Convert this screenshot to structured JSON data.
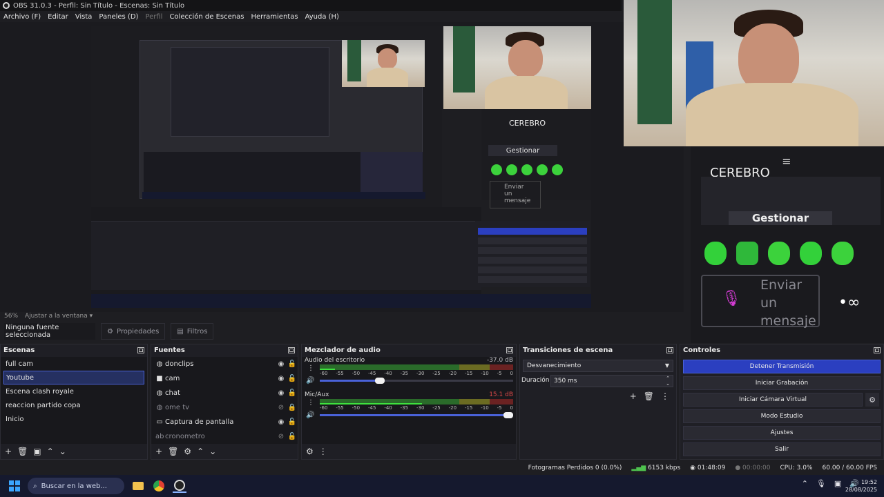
{
  "window": {
    "title": "OBS 31.0.3 - Perfil: Sin Título - Escenas: Sin Título"
  },
  "menu": [
    {
      "label": "Archivo (F)",
      "enabled": true
    },
    {
      "label": "Editar",
      "enabled": true
    },
    {
      "label": "Vista",
      "enabled": true
    },
    {
      "label": "Paneles (D)",
      "enabled": true
    },
    {
      "label": "Perfil",
      "enabled": false
    },
    {
      "label": "Colección de Escenas",
      "enabled": true
    },
    {
      "label": "Herramientas",
      "enabled": true
    },
    {
      "label": "Ayuda (H)",
      "enabled": true
    }
  ],
  "preview": {
    "zoom": "56%",
    "fit_label": "Ajustar a la ventana",
    "chat_overlay": {
      "title": "CEREBRO",
      "manage_label": "Gestionar",
      "send_label": "Enviar un mensaje"
    }
  },
  "source_toolbar": {
    "no_source": "Ninguna fuente seleccionada",
    "properties": "Propiedades",
    "filters": "Filtros"
  },
  "docks": {
    "scenes": {
      "title": "Escenas",
      "items": [
        {
          "label": "full cam",
          "active": false
        },
        {
          "label": "Youtube",
          "active": true
        },
        {
          "label": "Escena clash royale",
          "active": false
        },
        {
          "label": "reaccion partido copa",
          "active": false
        },
        {
          "label": "Inicio",
          "active": false
        }
      ]
    },
    "sources": {
      "title": "Fuentes",
      "items": [
        {
          "label": "donclips",
          "icon": "browser-icon",
          "visible": true,
          "locked": false
        },
        {
          "label": "cam",
          "icon": "camera-icon",
          "visible": true,
          "locked": false
        },
        {
          "label": "chat",
          "icon": "browser-icon",
          "visible": true,
          "locked": false
        },
        {
          "label": "ome tv",
          "icon": "browser-icon",
          "visible": false,
          "locked": true
        },
        {
          "label": "Captura de pantalla",
          "icon": "monitor-icon",
          "visible": true,
          "locked": false
        },
        {
          "label": "cronometro",
          "icon": "text-icon",
          "visible": false,
          "locked": false
        }
      ]
    },
    "mixer": {
      "title": "Mezclador de audio",
      "scale": [
        "-60",
        "-55",
        "-50",
        "-45",
        "-40",
        "-35",
        "-30",
        "-25",
        "-20",
        "-15",
        "-10",
        "-5",
        "0"
      ],
      "channels": [
        {
          "name": "Audio del escritorio",
          "db": "-37.0 dB",
          "db_color": "#b9b9c0",
          "level": 0.08,
          "volume": 0.3
        },
        {
          "name": "Mic/Aux",
          "db": "15.1 dB",
          "db_color": "#e24a4a",
          "level": 0.53,
          "volume": 1.0
        }
      ]
    },
    "transitions": {
      "title": "Transiciones de escena",
      "selected": "Desvanecimiento",
      "duration_label": "Duración",
      "duration_value": "350 ms"
    },
    "controls": {
      "title": "Controles",
      "buttons": [
        {
          "label": "Detener Transmisión",
          "primary": true
        },
        {
          "label": "Iniciar Grabación",
          "primary": false
        },
        {
          "label": "Iniciar Cámara Virtual",
          "primary": false
        },
        {
          "label": "Modo Estudio",
          "primary": false
        },
        {
          "label": "Ajustes",
          "primary": false
        },
        {
          "label": "Salir",
          "primary": false
        }
      ]
    }
  },
  "status": {
    "dropped": "Fotogramas Perdidos 0 (0.0%)",
    "bitrate": "6153 kbps",
    "stream_time": "01:48:09",
    "record_time": "00:00:00",
    "cpu": "CPU: 3.0%",
    "fps": "60.00 / 60.00 FPS"
  },
  "taskbar": {
    "search_placeholder": "Buscar en la web...",
    "time": "19:52",
    "date": "28/08/2025"
  },
  "colors": {
    "accent": "#2b3fc0",
    "meter_green": "#3ee23e",
    "meter_red": "#e24a4a"
  }
}
